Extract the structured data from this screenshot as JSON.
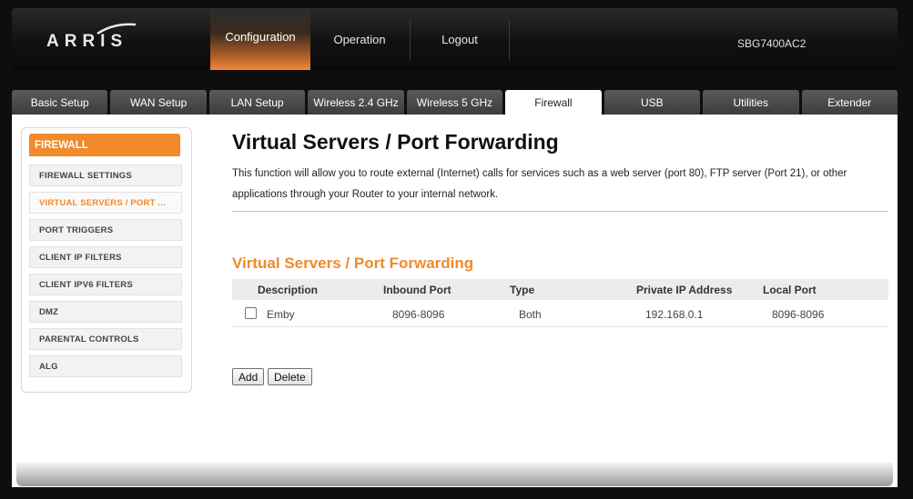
{
  "header": {
    "logo": "ARRIS",
    "nav": [
      "Configuration",
      "Operation",
      "Logout"
    ],
    "model": "SBG7400AC2"
  },
  "tabs": [
    "Basic Setup",
    "WAN Setup",
    "LAN Setup",
    "Wireless 2.4 GHz",
    "Wireless 5 GHz",
    "Firewall",
    "USB",
    "Utilities",
    "Extender"
  ],
  "active_tab": "Firewall",
  "sidebar": {
    "title": "FIREWALL",
    "items": [
      "FIREWALL SETTINGS",
      "VIRTUAL SERVERS / PORT ...",
      "PORT TRIGGERS",
      "CLIENT IP FILTERS",
      "CLIENT IPV6 FILTERS",
      "DMZ",
      "PARENTAL CONTROLS",
      "ALG"
    ],
    "active_item": "VIRTUAL SERVERS / PORT ..."
  },
  "page": {
    "title": "Virtual Servers / Port Forwarding",
    "description": "This function will allow you to route external (Internet) calls for services such as a web server (port 80), FTP server (Port 21), or other applications through your Router to your internal network.",
    "section_title": "Virtual Servers / Port Forwarding"
  },
  "table": {
    "columns": [
      "Description",
      "Inbound Port",
      "Type",
      "Private IP Address",
      "Local Port"
    ],
    "rows": [
      {
        "checked": false,
        "description": "Emby",
        "inbound_port": "8096-8096",
        "type": "Both",
        "private_ip": "192.168.0.1",
        "local_port": "8096-8096"
      }
    ]
  },
  "buttons": {
    "add": "Add",
    "delete": "Delete"
  },
  "colors": {
    "accent": "#f08a2a",
    "tab_bg": "#4a4a4a",
    "header_bg": "#111111"
  }
}
